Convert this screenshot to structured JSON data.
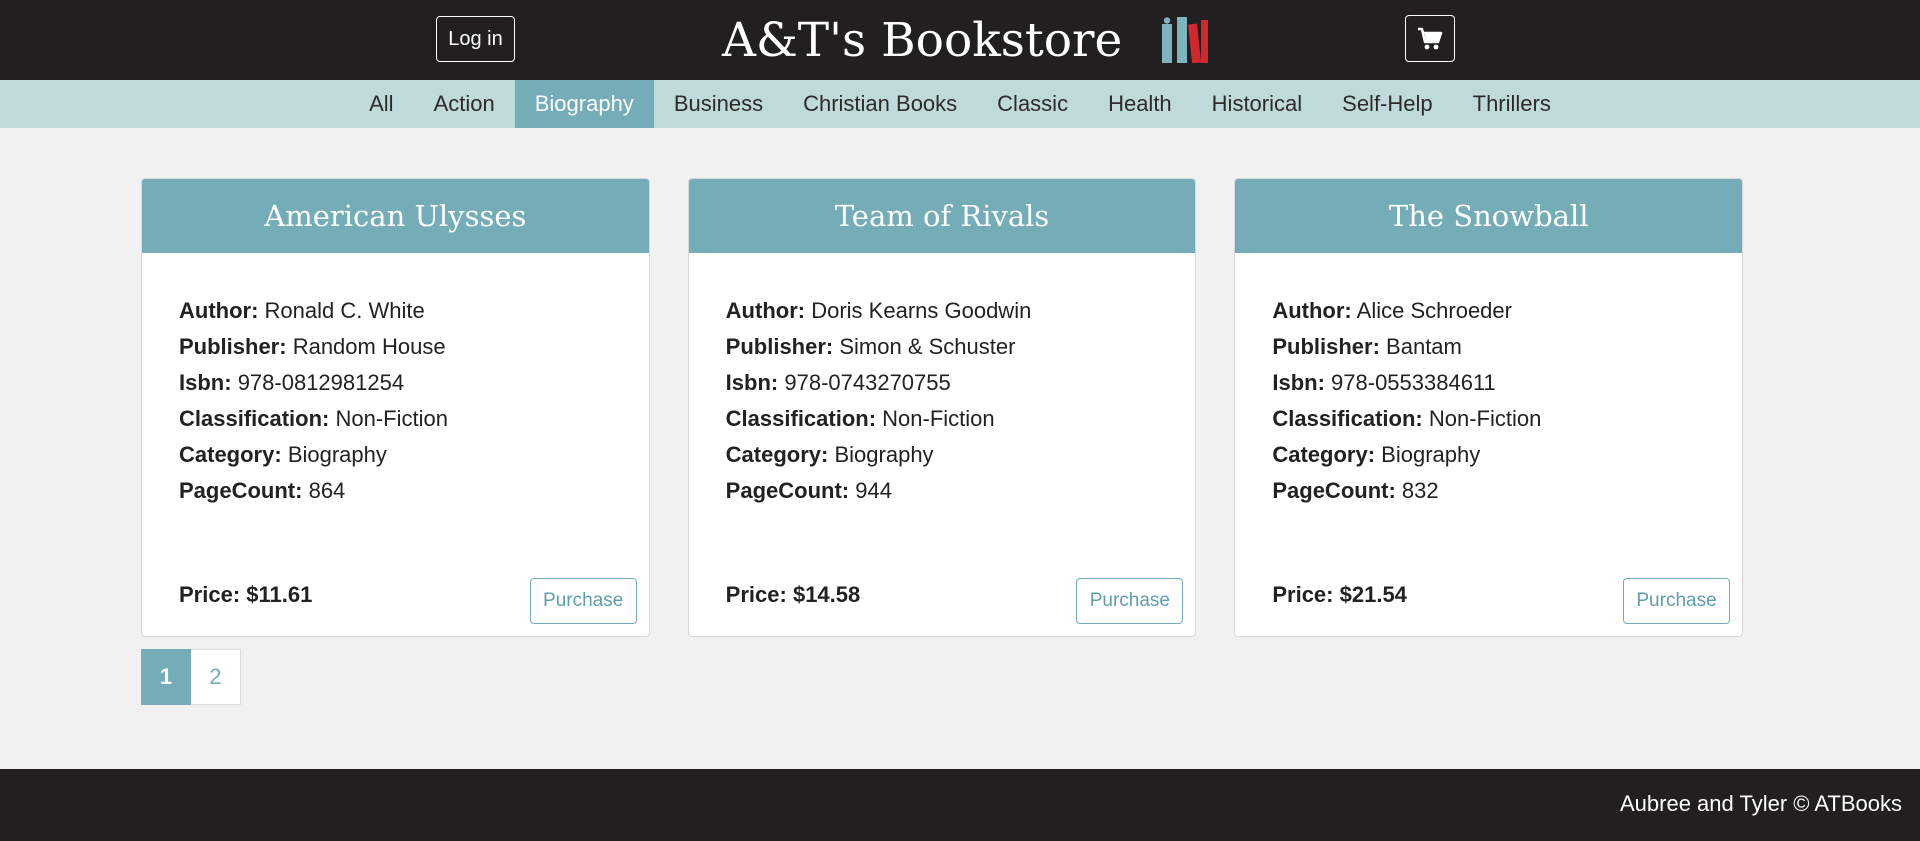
{
  "header": {
    "login_label": "Log in",
    "brand_title": "A&T's Bookstore",
    "logo_icon": "books-icon",
    "cart_icon": "shopping-cart-icon"
  },
  "categories": [
    {
      "label": "All",
      "active": false
    },
    {
      "label": "Action",
      "active": false
    },
    {
      "label": "Biography",
      "active": true
    },
    {
      "label": "Business",
      "active": false
    },
    {
      "label": "Christian Books",
      "active": false
    },
    {
      "label": "Classic",
      "active": false
    },
    {
      "label": "Health",
      "active": false
    },
    {
      "label": "Historical",
      "active": false
    },
    {
      "label": "Self-Help",
      "active": false
    },
    {
      "label": "Thrillers",
      "active": false
    }
  ],
  "field_labels": {
    "author": "Author:",
    "publisher": "Publisher:",
    "isbn": "Isbn:",
    "classification": "Classification:",
    "category": "Category:",
    "pagecount": "PageCount:",
    "price": "Price:"
  },
  "books": [
    {
      "title": "American Ulysses",
      "author": "Ronald C. White",
      "publisher": "Random House",
      "isbn": "978-0812981254",
      "classification": "Non-Fiction",
      "category": "Biography",
      "pagecount": "864",
      "price": "$11.61",
      "purchase_label": "Purchase"
    },
    {
      "title": "Team of Rivals",
      "author": "Doris Kearns Goodwin",
      "publisher": "Simon & Schuster",
      "isbn": "978-0743270755",
      "classification": "Non-Fiction",
      "category": "Biography",
      "pagecount": "944",
      "price": "$14.58",
      "purchase_label": "Purchase"
    },
    {
      "title": "The Snowball",
      "author": "Alice Schroeder",
      "publisher": "Bantam",
      "isbn": "978-0553384611",
      "classification": "Non-Fiction",
      "category": "Biography",
      "pagecount": "832",
      "price": "$21.54",
      "purchase_label": "Purchase"
    }
  ],
  "pagination": {
    "pages": [
      "1",
      "2"
    ],
    "current": "1"
  },
  "footer": {
    "text": "Aubree and Tyler © ATBooks"
  },
  "colors": {
    "header_bg": "#221f20",
    "nav_bg": "#c0dadb",
    "accent": "#74adb8",
    "page_bg": "#f1f1f1",
    "logo_red": "#d0282c",
    "logo_teal": "#7fb3c0"
  }
}
